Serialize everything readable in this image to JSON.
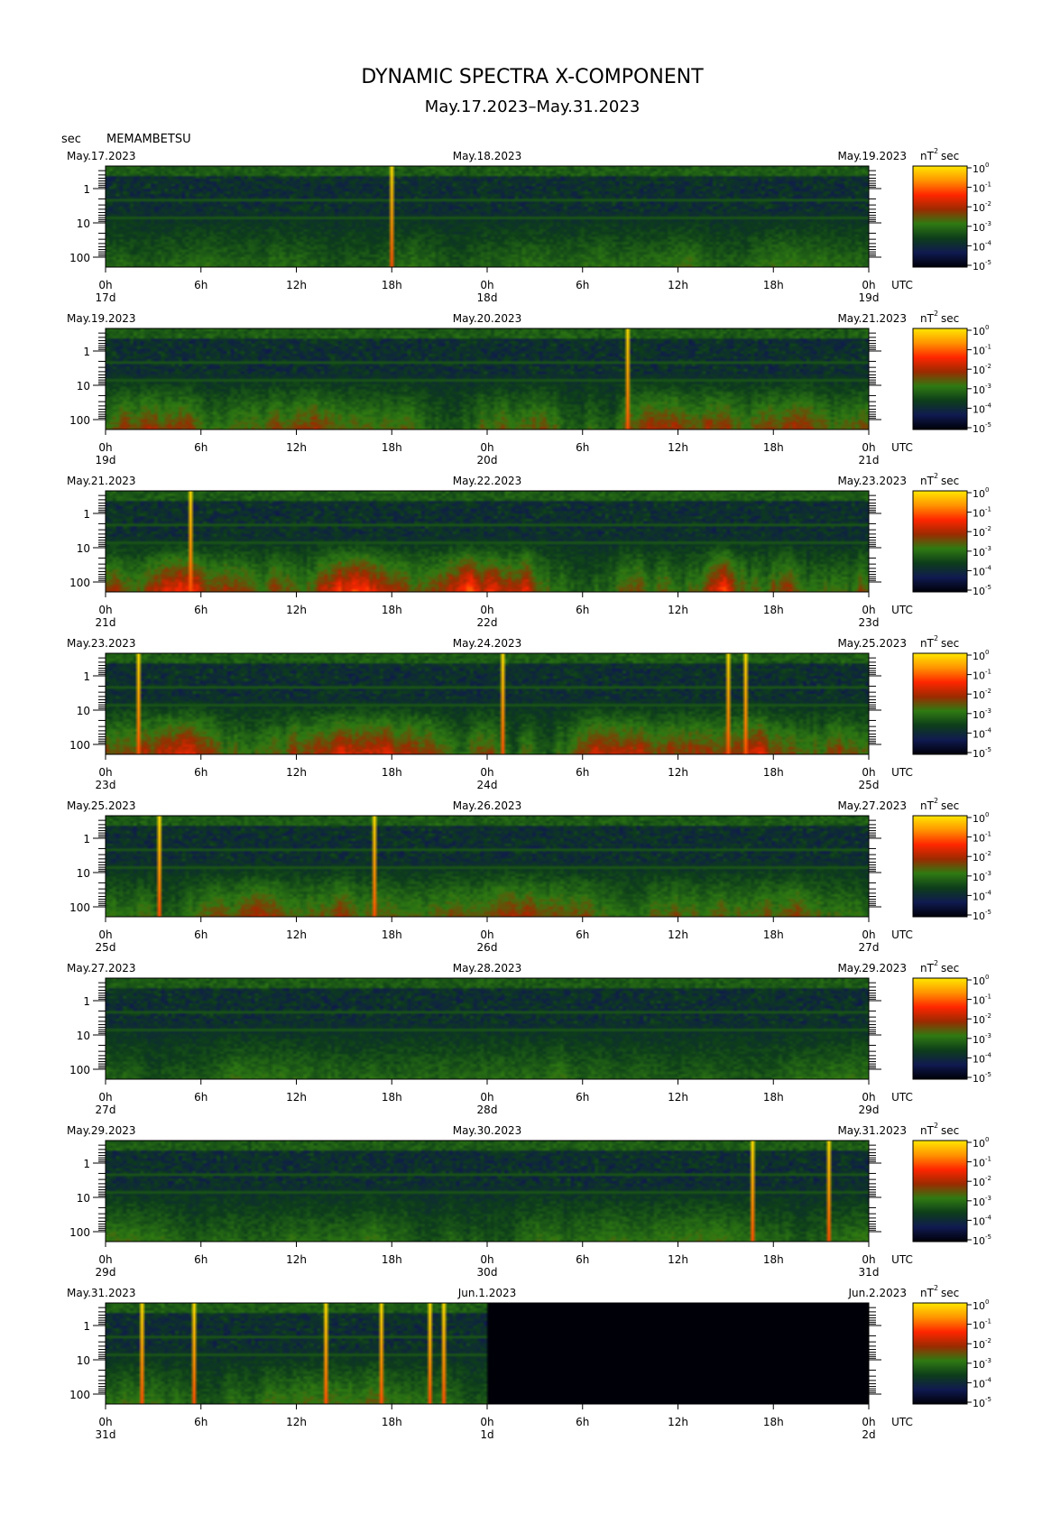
{
  "title": "DYNAMIC SPECTRA X-COMPONENT",
  "subtitle": "May.17.2023–May.31.2023",
  "station": "MEMAMBETSU",
  "y_unit": "sec",
  "colorbar_unit": "nT",
  "colorbar_unit_exp": "2",
  "colorbar_unit_suffix": "sec",
  "utc_label": "UTC",
  "colormap": [
    "#000008",
    "#101a50",
    "#0d3d1a",
    "#2f7a12",
    "#9c2a00",
    "#ff2600",
    "#ff9400",
    "#ffe800"
  ],
  "chart_data": {
    "type": "heatmap",
    "x_ticks": [
      "0h",
      "6h",
      "12h",
      "18h",
      "0h",
      "6h",
      "12h",
      "18h",
      "0h"
    ],
    "y_tick_labels": [
      "1",
      "10",
      "100"
    ],
    "y_scale": "log",
    "colorbar": {
      "scale": "log",
      "tick_base": "10",
      "tick_exponents": [
        "0",
        "-1",
        "-2",
        "-3",
        "-4",
        "-5"
      ]
    },
    "panels": [
      {
        "start": "May.17.2023",
        "mid": "May.18.2023",
        "end": "May.19.2023",
        "days": [
          "17d",
          "18d",
          "19d"
        ],
        "activity": 0.22,
        "bursts_hours": [
          17.8
        ],
        "missing_from_hour": null
      },
      {
        "start": "May.19.2023",
        "mid": "May.20.2023",
        "end": "May.21.2023",
        "days": [
          "19d",
          "20d",
          "21d"
        ],
        "activity": 0.55,
        "bursts_hours": [
          32.8
        ],
        "missing_from_hour": null
      },
      {
        "start": "May.21.2023",
        "mid": "May.22.2023",
        "end": "May.23.2023",
        "days": [
          "21d",
          "22d",
          "23d"
        ],
        "activity": 0.75,
        "bursts_hours": [
          5.3
        ],
        "missing_from_hour": null
      },
      {
        "start": "May.23.2023",
        "mid": "May.24.2023",
        "end": "May.25.2023",
        "days": [
          "23d",
          "24d",
          "25d"
        ],
        "activity": 0.6,
        "bursts_hours": [
          1.9,
          24.8,
          39.0,
          40.1
        ],
        "missing_from_hour": null
      },
      {
        "start": "May.25.2023",
        "mid": "May.26.2023",
        "end": "May.27.2023",
        "days": [
          "25d",
          "26d",
          "27d"
        ],
        "activity": 0.45,
        "bursts_hours": [
          3.2,
          16.8
        ],
        "missing_from_hour": null
      },
      {
        "start": "May.27.2023",
        "mid": "May.28.2023",
        "end": "May.29.2023",
        "days": [
          "27d",
          "28d",
          "29d"
        ],
        "activity": 0.2,
        "bursts_hours": [],
        "missing_from_hour": null
      },
      {
        "start": "May.29.2023",
        "mid": "May.30.2023",
        "end": "May.31.2023",
        "days": [
          "29d",
          "30d",
          "31d"
        ],
        "activity": 0.28,
        "bursts_hours": [
          40.6,
          45.4
        ],
        "missing_from_hour": null
      },
      {
        "start": "May.31.2023",
        "mid": "Jun.1.2023",
        "end": "Jun.2.2023",
        "days": [
          "31d",
          "1d",
          "2d"
        ],
        "activity": 0.32,
        "bursts_hours": [
          2.1,
          5.4,
          13.8,
          17.2,
          20.3,
          21.1
        ],
        "missing_from_hour": 24
      }
    ]
  }
}
